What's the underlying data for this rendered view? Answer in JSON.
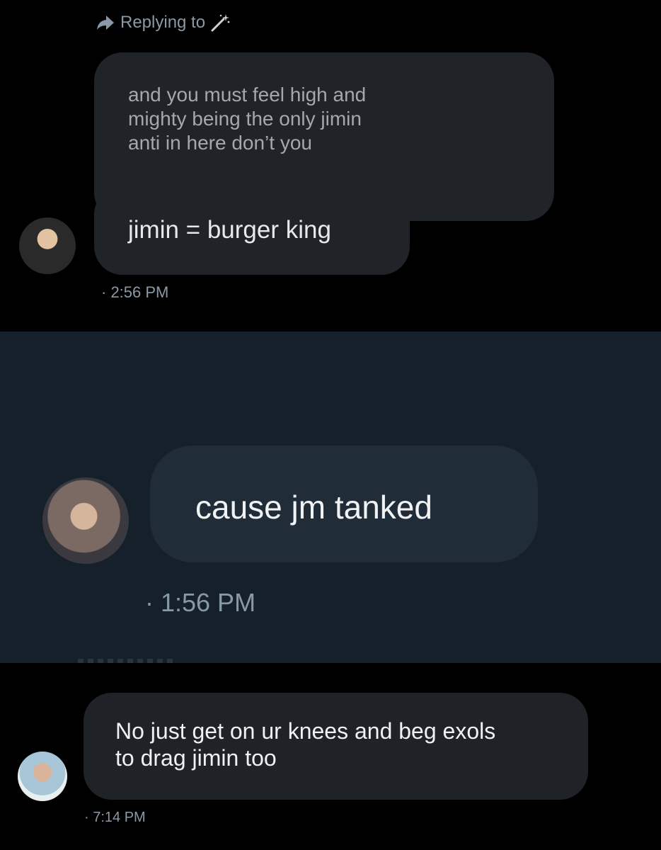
{
  "conversation_1": {
    "replying_label": "Replying to",
    "quoted_text": "and you must feel high and\nmighty being the only jimin\nanti in here don’t you",
    "message": "jimin = burger king",
    "timestamp": "· 2:56 PM"
  },
  "conversation_2": {
    "message": "cause jm tanked",
    "timestamp": "· 1:56 PM"
  },
  "conversation_3": {
    "message": "No just get on ur knees and beg exols\nto drag jimin too",
    "timestamp": "· 7:14 PM"
  },
  "colors": {
    "background": "#000000",
    "dim_background": "#15202b",
    "bubble": "#202327",
    "muted_text": "#8b98a5"
  }
}
